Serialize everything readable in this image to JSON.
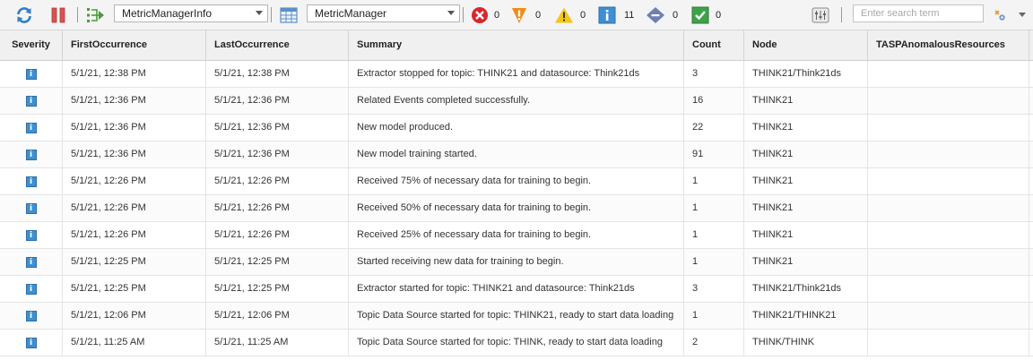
{
  "toolbar": {
    "refresh_icon": "refresh-icon",
    "pause_icon": "pause-icon",
    "filter_icon": "filter-icon",
    "filter_dropdown": {
      "value": "MetricManagerInfo"
    },
    "view_icon": "view-table-icon",
    "view_dropdown": {
      "value": "MetricManager"
    },
    "counts": {
      "critical": "0",
      "major": "0",
      "warning": "0",
      "info": "11",
      "indeterminate": "0",
      "clear": "0"
    },
    "search": {
      "placeholder": "Enter search term",
      "value": ""
    }
  },
  "colors": {
    "critical": "#d9262c",
    "major": "#f28a17",
    "warning": "#f5c518",
    "info": "#3f8fd1",
    "indeterminate": "#6f7fb3",
    "clear": "#3ea24a"
  },
  "table": {
    "columns": [
      "Severity",
      "FirstOccurrence",
      "LastOccurrence",
      "Summary",
      "Count",
      "Node",
      "TASPAnomalousResources"
    ],
    "rows": [
      {
        "severity": "info",
        "first": "5/1/21, 12:38 PM",
        "last": "5/1/21, 12:38 PM",
        "summary": "Extractor stopped for topic: THINK21 and datasource: Think21ds",
        "count": "3",
        "node": "THINK21/Think21ds",
        "tasp": ""
      },
      {
        "severity": "info",
        "first": "5/1/21, 12:36 PM",
        "last": "5/1/21, 12:36 PM",
        "summary": "Related Events completed successfully.",
        "count": "16",
        "node": "THINK21",
        "tasp": ""
      },
      {
        "severity": "info",
        "first": "5/1/21, 12:36 PM",
        "last": "5/1/21, 12:36 PM",
        "summary": "New model produced.",
        "count": "22",
        "node": "THINK21",
        "tasp": ""
      },
      {
        "severity": "info",
        "first": "5/1/21, 12:36 PM",
        "last": "5/1/21, 12:36 PM",
        "summary": "New model training started.",
        "count": "91",
        "node": "THINK21",
        "tasp": ""
      },
      {
        "severity": "info",
        "first": "5/1/21, 12:26 PM",
        "last": "5/1/21, 12:26 PM",
        "summary": "Received 75% of necessary data for training to begin.",
        "count": "1",
        "node": "THINK21",
        "tasp": ""
      },
      {
        "severity": "info",
        "first": "5/1/21, 12:26 PM",
        "last": "5/1/21, 12:26 PM",
        "summary": "Received 50% of necessary data for training to begin.",
        "count": "1",
        "node": "THINK21",
        "tasp": ""
      },
      {
        "severity": "info",
        "first": "5/1/21, 12:26 PM",
        "last": "5/1/21, 12:26 PM",
        "summary": "Received 25% of necessary data for training to begin.",
        "count": "1",
        "node": "THINK21",
        "tasp": ""
      },
      {
        "severity": "info",
        "first": "5/1/21, 12:25 PM",
        "last": "5/1/21, 12:25 PM",
        "summary": "Started receiving new data for training to begin.",
        "count": "1",
        "node": "THINK21",
        "tasp": ""
      },
      {
        "severity": "info",
        "first": "5/1/21, 12:25 PM",
        "last": "5/1/21, 12:25 PM",
        "summary": "Extractor started for topic: THINK21 and datasource: Think21ds",
        "count": "3",
        "node": "THINK21/Think21ds",
        "tasp": ""
      },
      {
        "severity": "info",
        "first": "5/1/21, 12:06 PM",
        "last": "5/1/21, 12:06 PM",
        "summary": "Topic Data Source started for topic: THINK21, ready to start data loading",
        "count": "1",
        "node": "THINK21/THINK21",
        "tasp": ""
      },
      {
        "severity": "info",
        "first": "5/1/21, 11:25 AM",
        "last": "5/1/21, 11:25 AM",
        "summary": "Topic Data Source started for topic: THINK, ready to start data loading",
        "count": "2",
        "node": "THINK/THINK",
        "tasp": ""
      }
    ]
  }
}
